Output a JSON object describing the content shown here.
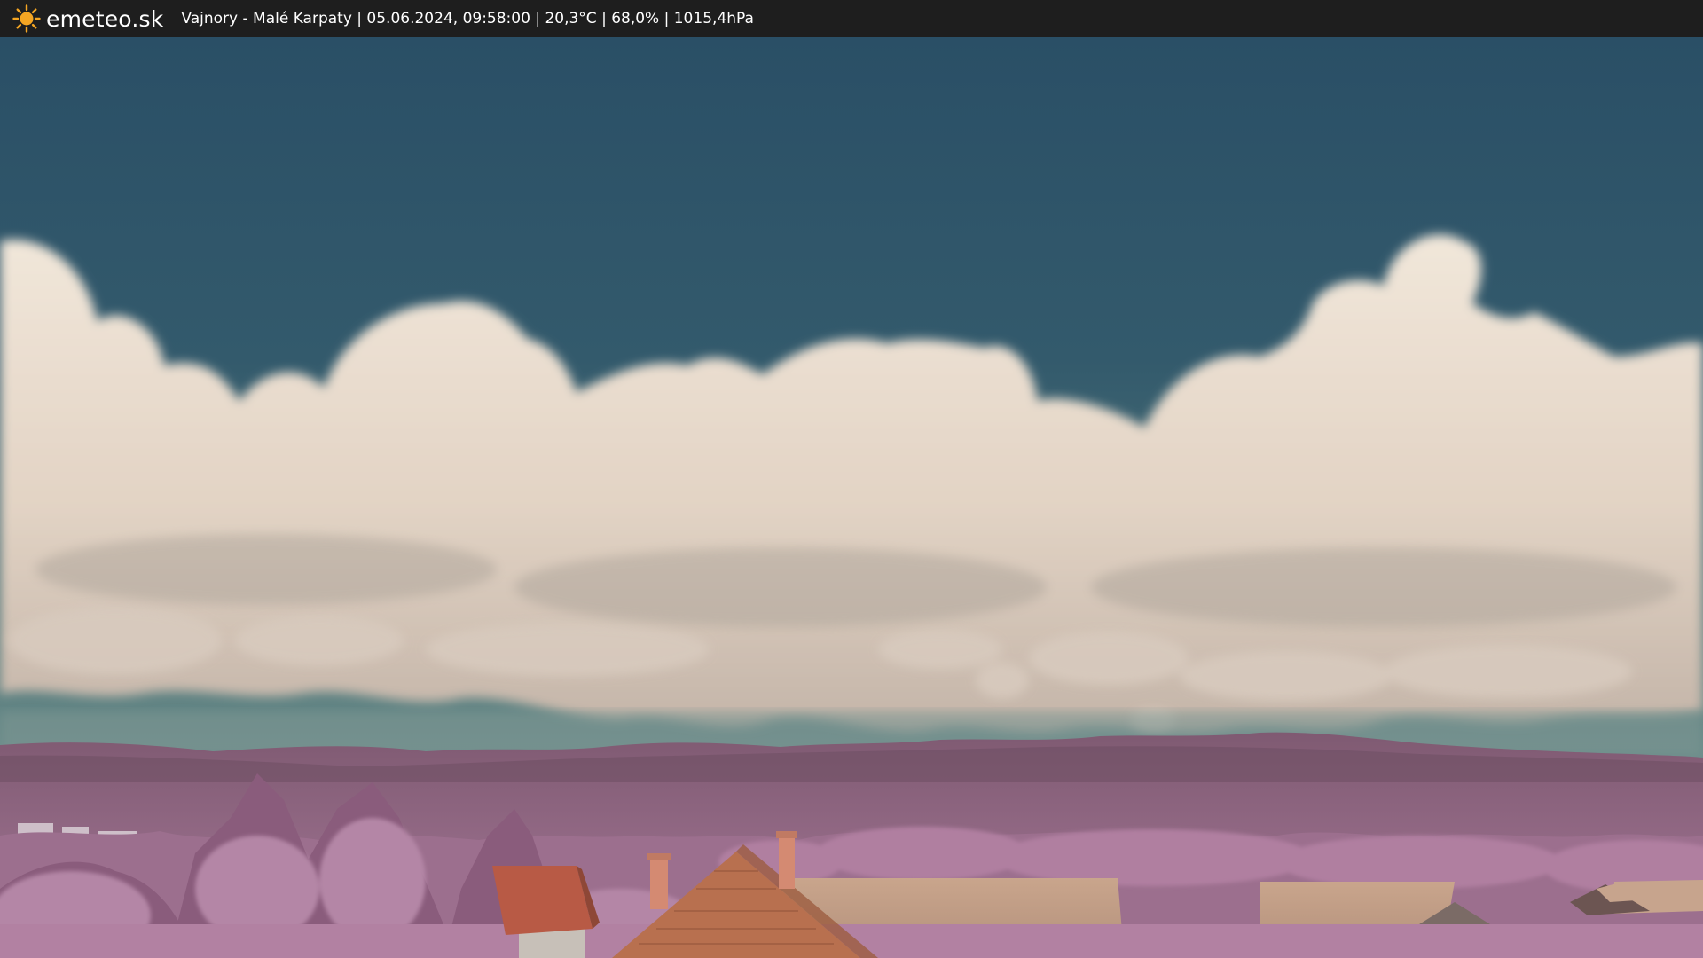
{
  "header": {
    "brand": "emeteo.sk",
    "logo_icon": "sun-icon",
    "status_line": "Vajnory - Malé Karpaty | 05.06.2024, 09:58:00 | 20,3°C | 68,0% | 1015,4hPa"
  },
  "colors": {
    "bar_bg": "#1e1e1e",
    "sun": "#f5a623",
    "sky_top": "#2a4f66",
    "sky_bottom": "#6e8f8c",
    "cloud": "#e9ddd0",
    "vegetation": "#a67395",
    "roof": "#b86a4e"
  }
}
